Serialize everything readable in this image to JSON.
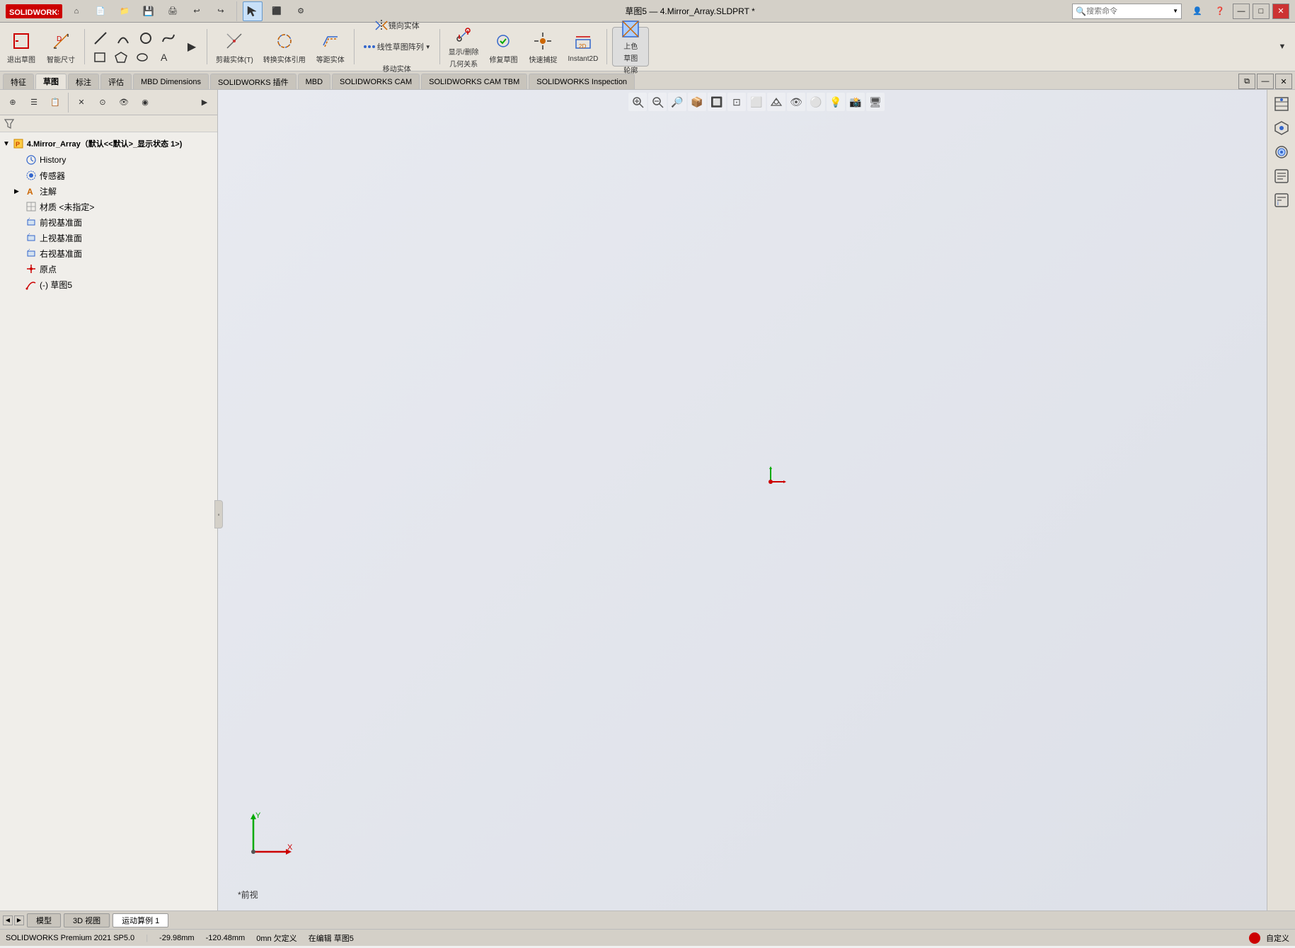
{
  "titleBar": {
    "logo": "SOLIDWORKS",
    "title": "草图5 — 4.Mirror_Array.SLDPRT *",
    "searchPlaceholder": "搜索命令",
    "windowControls": [
      "_",
      "□",
      "×"
    ]
  },
  "toolbar": {
    "row1": {
      "quickAccessBtns": [
        "⌂",
        "📄",
        "💾",
        "🖨",
        "↩",
        "↪",
        "↖"
      ],
      "toolBtns": [
        "▶",
        "🔲",
        "⚙",
        "—"
      ]
    },
    "row2": {
      "groups": [
        {
          "label": "退出草图",
          "icon": "◁"
        },
        {
          "label": "智能尺寸",
          "icon": "📐"
        },
        {
          "label": "",
          "icon": "剪裁实体(T)"
        },
        {
          "label": "",
          "icon": "转换实体引用"
        },
        {
          "label": "",
          "icon": "等距实体"
        },
        {
          "label": "",
          "icon": "镜向实体"
        },
        {
          "label": "",
          "icon": "线性草图阵列▼"
        },
        {
          "label": "显示/删除几何关系",
          "icon": "🔗"
        },
        {
          "label": "修复草图",
          "icon": "🔧"
        },
        {
          "label": "快速捕捉",
          "icon": "🧲"
        },
        {
          "label": "Instant2D",
          "icon": "📏"
        },
        {
          "label": "上色草图轮廓",
          "icon": "🎨"
        }
      ]
    }
  },
  "tabs": {
    "main": [
      "特征",
      "草图",
      "标注",
      "评估",
      "MBD Dimensions",
      "SOLIDWORKS 插件",
      "MBD",
      "SOLIDWORKS CAM",
      "SOLIDWORKS CAM TBM",
      "SOLIDWORKS Inspection"
    ],
    "active": "草图"
  },
  "leftPanel": {
    "toolbar": {
      "icons": [
        "⊕",
        "☰",
        "📋",
        "✕",
        "⊙",
        "👁",
        "◉",
        "▶"
      ]
    },
    "treeRoot": "4.Mirror_Array（默认<<默认>_显示状态 1>)",
    "treeItems": [
      {
        "id": "history",
        "label": "History",
        "icon": "🕐",
        "indent": 1
      },
      {
        "id": "sensors",
        "label": "传感器",
        "icon": "📡",
        "indent": 1
      },
      {
        "id": "annotations",
        "label": "注解",
        "icon": "A",
        "indent": 1,
        "hasExpand": true
      },
      {
        "id": "material",
        "label": "材质 <未指定>",
        "icon": "⚙",
        "indent": 1
      },
      {
        "id": "front-plane",
        "label": "前视基准面",
        "icon": "▫",
        "indent": 1
      },
      {
        "id": "top-plane",
        "label": "上视基准面",
        "icon": "▫",
        "indent": 1
      },
      {
        "id": "right-plane",
        "label": "右视基准面",
        "icon": "▫",
        "indent": 1
      },
      {
        "id": "origin",
        "label": "原点",
        "icon": "⊕",
        "indent": 1
      },
      {
        "id": "sketch5",
        "label": "(-) 草图5",
        "icon": "✏",
        "indent": 1
      }
    ]
  },
  "viewport": {
    "toolbarIcons": [
      "🔍",
      "🔎",
      "👁",
      "📦",
      "🔲",
      "🎯",
      "⬜",
      "👁",
      "⚪",
      "💡",
      "📸",
      "🖥"
    ],
    "label": "*前视",
    "coords": {
      "x": "-29.98mm",
      "y": "-120.48mm"
    }
  },
  "rightIcons": [
    "⊕",
    "📦",
    "🌍",
    "📊",
    "☰"
  ],
  "bottomTabs": [
    "模型",
    "3D 视图",
    "运动算例 1"
  ],
  "activeBottomTab": "运动算例 1",
  "statusBar": {
    "appName": "SOLIDWORKS Premium 2021 SP5.0",
    "coords": "-29.98mm",
    "yCoords": "-120.48mm",
    "extra": "0mn 欠定义",
    "status1": "在编辑 草图5",
    "status2": "自定义"
  }
}
